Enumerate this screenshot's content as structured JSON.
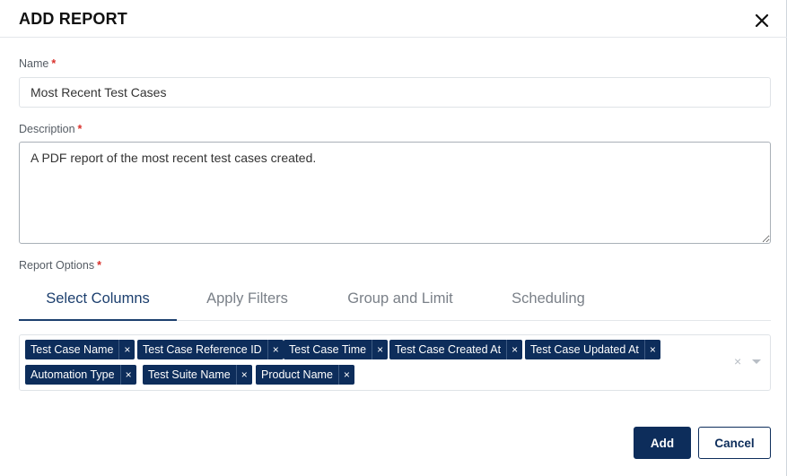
{
  "dialog": {
    "title": "ADD REPORT"
  },
  "name_field": {
    "label": "Name",
    "required_mark": "*",
    "value": "Most Recent Test Cases"
  },
  "description_field": {
    "label": "Description",
    "required_mark": "*",
    "value": "A PDF report of the most recent test cases created."
  },
  "report_options": {
    "label": "Report Options",
    "required_mark": "*",
    "tabs": [
      {
        "label": "Select Columns",
        "active": true
      },
      {
        "label": "Apply Filters",
        "active": false
      },
      {
        "label": "Group and Limit",
        "active": false
      },
      {
        "label": "Scheduling",
        "active": false
      }
    ],
    "selected_columns": [
      {
        "label": "Test Case Name",
        "remove": "×"
      },
      {
        "label": "Test Case Reference ID",
        "remove": "×"
      },
      {
        "label": "Test Case Time",
        "remove": "×"
      },
      {
        "label": "Test Case Created At",
        "remove": "×"
      },
      {
        "label": "Test Case Updated At",
        "remove": "×"
      },
      {
        "label": "Automation Type",
        "remove": "×"
      },
      {
        "label": "Test Suite Name",
        "remove": "×"
      },
      {
        "label": "Product Name",
        "remove": "×"
      }
    ],
    "clear_all": "×"
  },
  "footer": {
    "add_label": "Add",
    "cancel_label": "Cancel"
  },
  "colors": {
    "primary": "#0d2d5b",
    "required": "#d9302b",
    "active_tab": "#1c3f6e"
  }
}
